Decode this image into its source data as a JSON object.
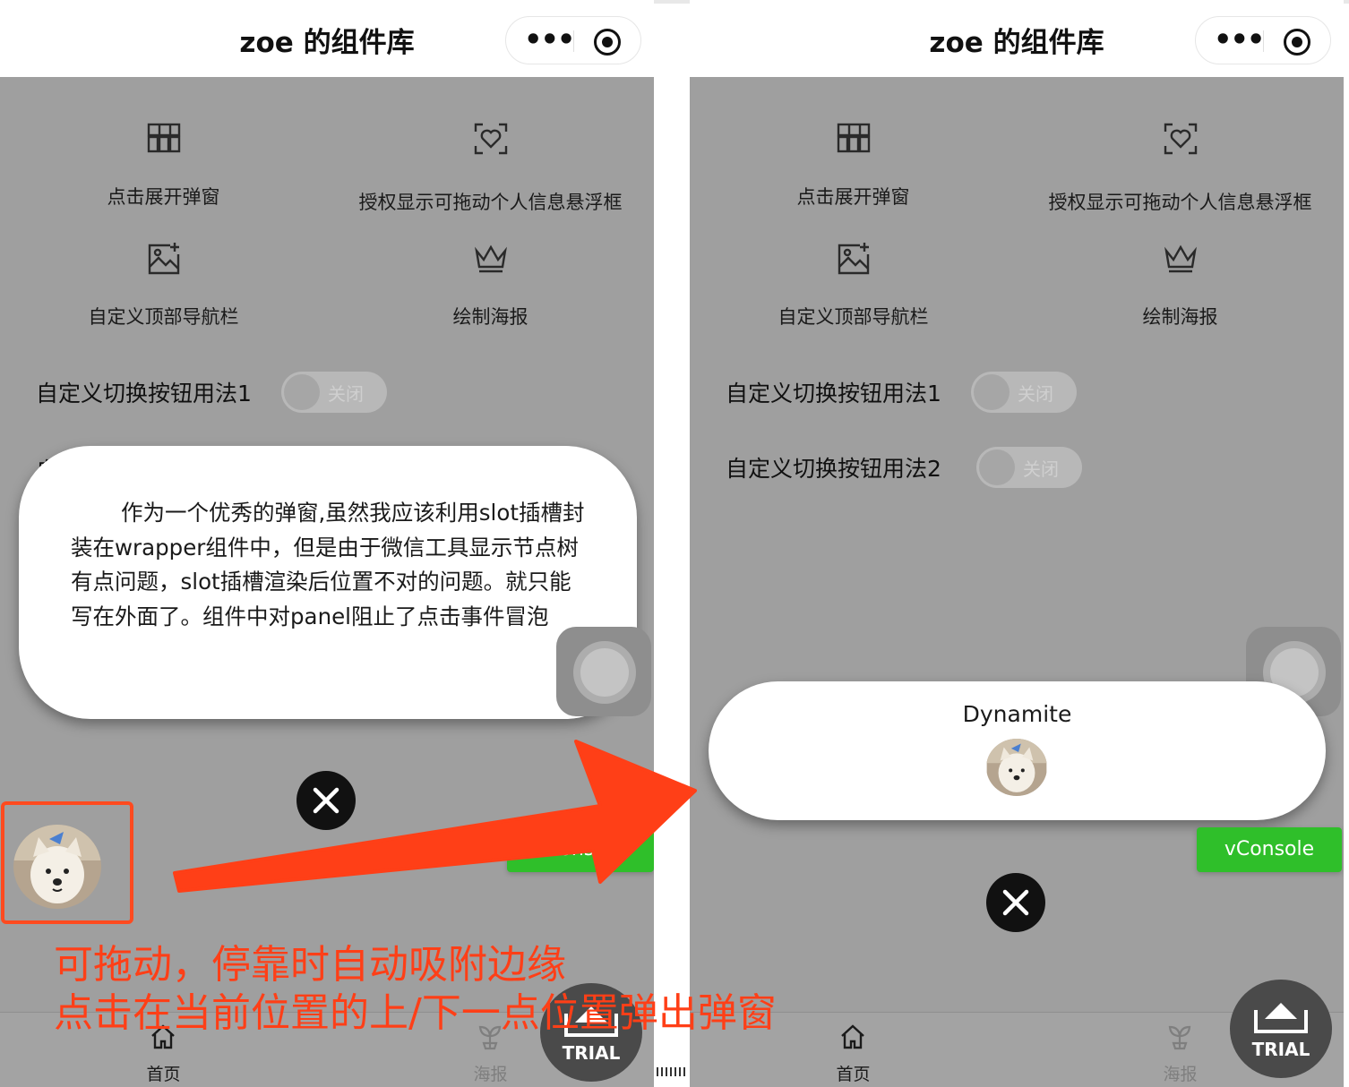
{
  "screens": {
    "left": {
      "navbar": {
        "title": "zoe 的组件库",
        "more_icon": "more-dots-icon",
        "record_icon": "record-target-icon"
      },
      "grid": [
        {
          "label": "点击展开弹窗",
          "icon": "grid-layout-icon"
        },
        {
          "label": "授权显示可拖动个人信息悬浮框",
          "icon": "heart-scan-icon"
        },
        {
          "label": "自定义顶部导航栏",
          "icon": "image-add-icon"
        },
        {
          "label": "绘制海报",
          "icon": "crown-icon"
        }
      ],
      "toggle1": {
        "label": "自定义切换按钮用法1",
        "state": "关闭"
      },
      "toggle2_partial": {
        "label": "自"
      },
      "popup": {
        "text": "作为一个优秀的弹窗,虽然我应该利用slot插槽封装在wrapper组件中，但是由于微信工具显示节点树有点问题，slot插槽渲染后位置不对的问题。就只能写在外面了。组件中对panel阻止了点击事件冒泡"
      },
      "vconsole": {
        "label": "vConsole"
      },
      "tabbar": [
        {
          "label": "首页",
          "icon": "home-icon"
        },
        {
          "label": "海报",
          "icon": "sprout-icon"
        }
      ],
      "trial": {
        "label": "TRIAL"
      }
    },
    "right": {
      "navbar": {
        "title": "zoe 的组件库",
        "more_icon": "more-dots-icon",
        "record_icon": "record-target-icon"
      },
      "grid": [
        {
          "label": "点击展开弹窗",
          "icon": "grid-layout-icon"
        },
        {
          "label": "授权显示可拖动个人信息悬浮框",
          "icon": "heart-scan-icon"
        },
        {
          "label": "自定义顶部导航栏",
          "icon": "image-add-icon"
        },
        {
          "label": "绘制海报",
          "icon": "crown-icon"
        }
      ],
      "toggle1": {
        "label": "自定义切换按钮用法1",
        "state": "关闭"
      },
      "toggle2": {
        "label": "自定义切换按钮用法2",
        "state": "关闭"
      },
      "popup": {
        "name": "Dynamite"
      },
      "vconsole": {
        "label": "vConsole"
      },
      "tabbar": [
        {
          "label": "首页",
          "icon": "home-icon"
        },
        {
          "label": "海报",
          "icon": "sprout-icon"
        }
      ],
      "trial": {
        "label": "TRIAL"
      }
    }
  },
  "annotation": {
    "line1": "可拖动，停靠时自动吸附边缘",
    "line2": "点击在当前位置的上/下一点位置弹出弹窗",
    "color": "#ff3f17"
  },
  "colors": {
    "overlay": "#9f9f9f",
    "vconsole": "#2fbf2a",
    "annotation": "#ff4a1f"
  }
}
